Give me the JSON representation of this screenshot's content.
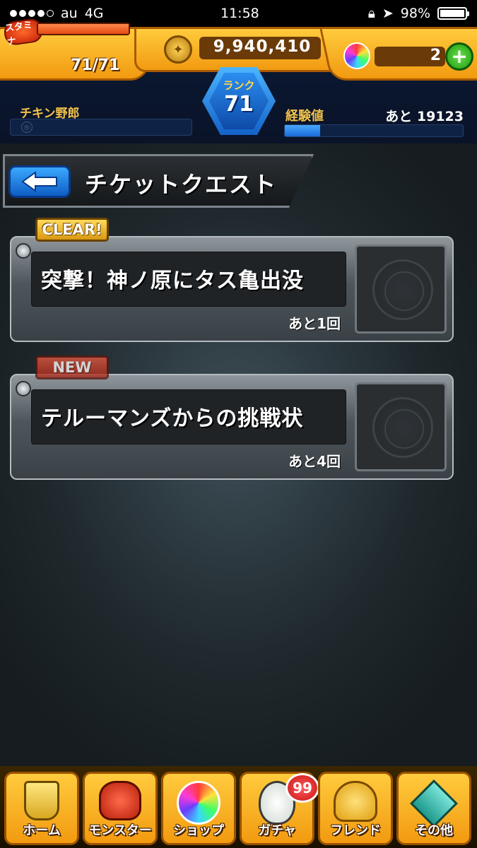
{
  "status_bar": {
    "carrier": "au",
    "network": "4G",
    "time": "11:58",
    "battery": "98%",
    "signal_bars": 4,
    "signal_total": 5
  },
  "header": {
    "stamina_badge": "スタミナ",
    "stamina": "71/71",
    "stamina_fill": 1.0,
    "coins": "9,940,410",
    "gems": "2",
    "gem_add": "+",
    "rank_label": "ランク",
    "rank_value": "71",
    "player_name": "チキン野郎",
    "player_marker": "®",
    "exp_label": "経験値",
    "exp_remaining": "あと 19123",
    "exp_fill": 0.2
  },
  "page": {
    "title": "チケットクエスト"
  },
  "quests": [
    {
      "badge": "CLEAR!",
      "title": "突撃！神ノ原にタス亀出没",
      "remaining": "あと1回"
    },
    {
      "badge": "NEW",
      "title": "テルーマンズからの挑戦状",
      "remaining": "あと4回"
    }
  ],
  "bottom_nav": {
    "items": [
      {
        "label": "ホーム",
        "icon": "home-icon"
      },
      {
        "label": "モンスター",
        "icon": "monster-icon"
      },
      {
        "label": "ショップ",
        "icon": "orb-icon"
      },
      {
        "label": "ガチャ",
        "icon": "egg-icon"
      },
      {
        "label": "フレンド",
        "icon": "friends-icon"
      },
      {
        "label": "その他",
        "icon": "more-icon"
      }
    ],
    "gacha_count": "99"
  },
  "colors": {
    "accent_orange": "#f29a10",
    "accent_blue": "#1a6ad8",
    "card_gray": "#4e565c"
  }
}
